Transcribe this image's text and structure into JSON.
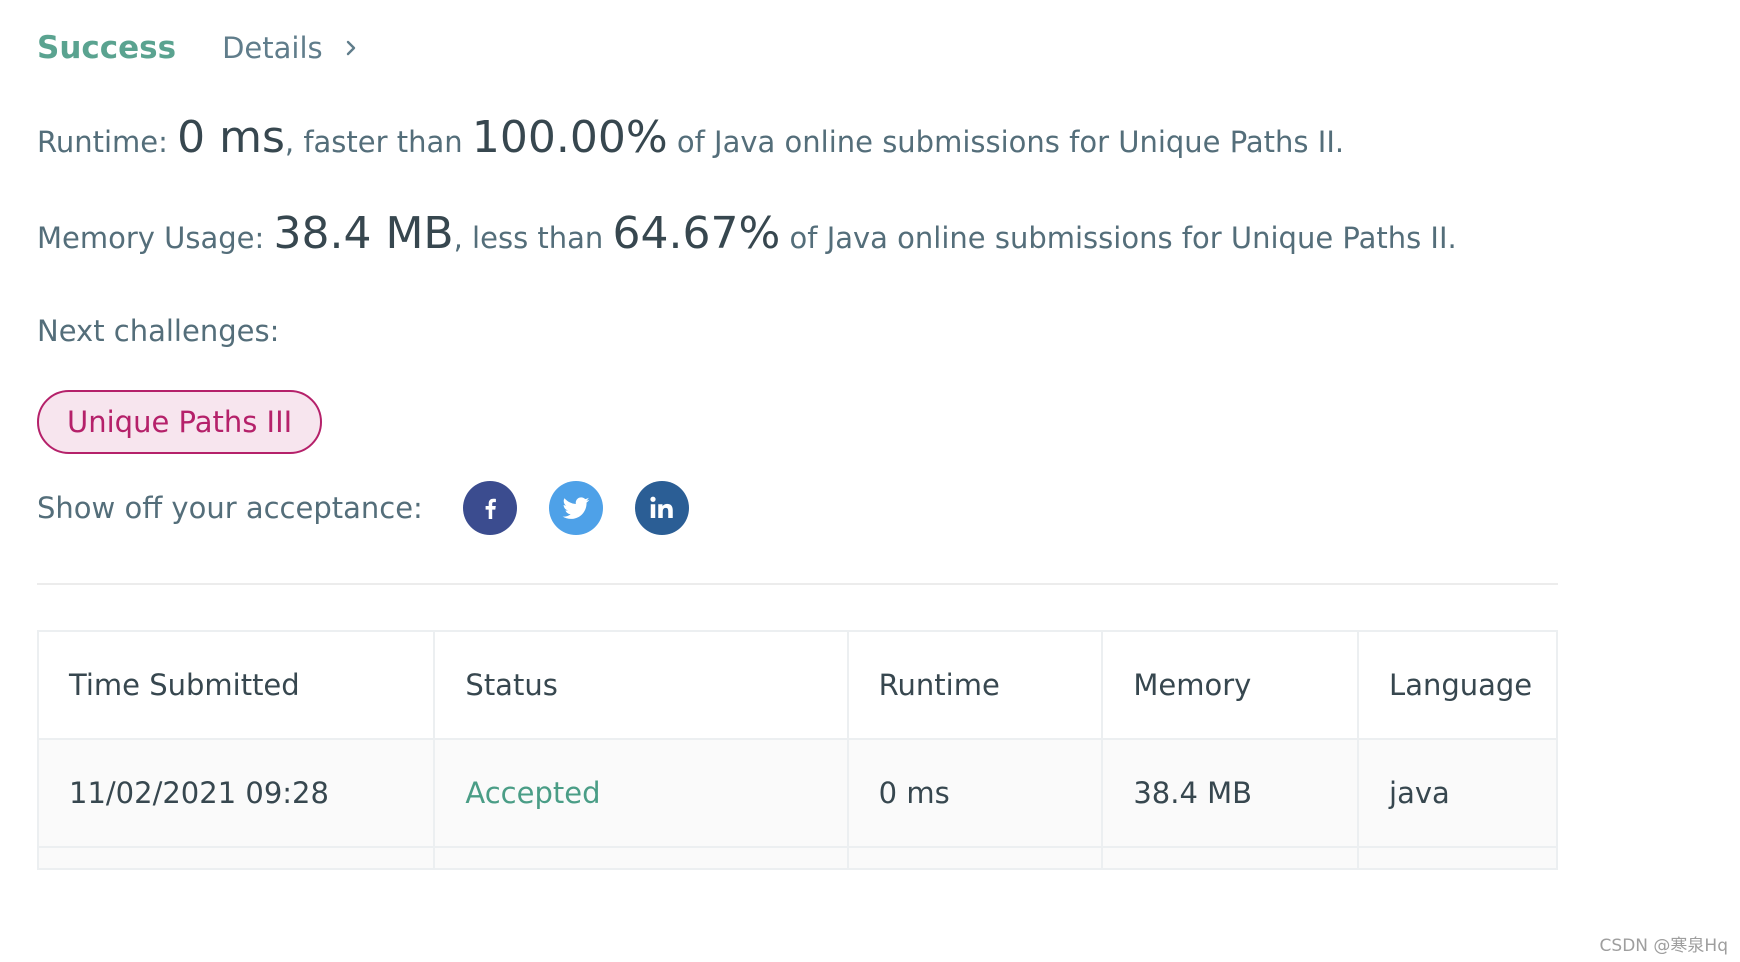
{
  "header": {
    "status": "Success",
    "details_label": "Details"
  },
  "runtime_line": {
    "label": "Runtime: ",
    "value": "0 ms",
    "comparison": ", faster than ",
    "percent": "100.00%",
    "suffix": " of Java online submissions for Unique Paths II."
  },
  "memory_line": {
    "label": "Memory Usage: ",
    "value": "38.4 MB",
    "comparison": ", less than ",
    "percent": "64.67%",
    "suffix": " of Java online submissions for Unique Paths II."
  },
  "next_challenges": {
    "label": "Next challenges:",
    "items": [
      "Unique Paths III"
    ]
  },
  "share": {
    "label": "Show off your acceptance:",
    "icons": [
      "facebook-icon",
      "twitter-icon",
      "linkedin-icon"
    ]
  },
  "table": {
    "headers": [
      "Time Submitted",
      "Status",
      "Runtime",
      "Memory",
      "Language"
    ],
    "rows": [
      {
        "time": "11/02/2021 09:28",
        "status": "Accepted",
        "runtime": "0 ms",
        "memory": "38.4 MB",
        "language": "java"
      }
    ]
  },
  "colors": {
    "success": "#5aa390",
    "challenge": "#b5216a",
    "facebook": "#3b4c8f",
    "twitter": "#4ea1e8",
    "linkedin": "#2b5e95"
  },
  "watermark": "CSDN @寒泉Hq"
}
